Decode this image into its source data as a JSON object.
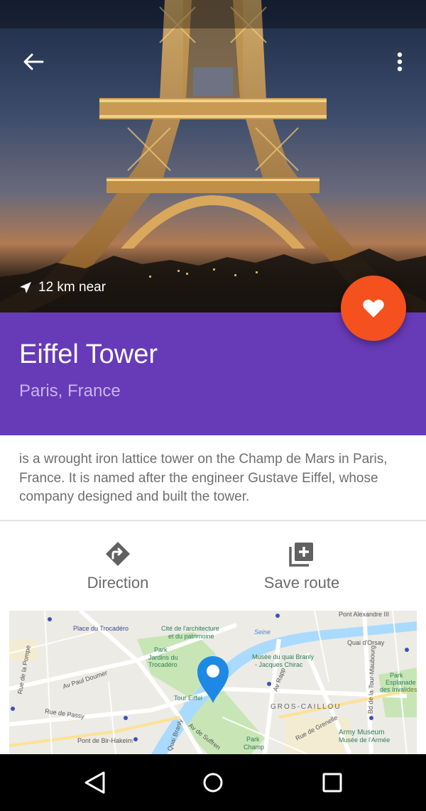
{
  "hero": {
    "distance_text": "12 km near"
  },
  "place": {
    "title": "Eiffel Tower",
    "subtitle": "Paris, France",
    "description": "is a wrought iron lattice tower on the Champ de Mars in Paris, France. It is named after the engineer Gustave Eiffel, whose company designed and built the tower."
  },
  "actions": {
    "direction_label": "Direction",
    "save_label": "Save route"
  },
  "map": {
    "labels": {
      "pont_alexandre": "Pont Alexandre III",
      "trocadero": "Place du Trocadéro",
      "cite_archi_1": "Cité de l'architecture",
      "cite_archi_2": "et du patrimoine",
      "seine": "Seine",
      "quai_orsay": "Quai d'Orsay",
      "jardins_1": "Park",
      "jardins_2": "Jardins du",
      "jardins_3": "Trocadéro",
      "branly_1": "Musée du quai Branly",
      "branly_2": "- Jacques Chirac",
      "paul_doumer": "Av Paul Doumer",
      "rue_pompe": "Rue de la Pompe",
      "invalides_1": "Park",
      "invalides_2": "Esplanade",
      "invalides_3": "des Invalides",
      "tour_eiffel": "Tour Eiffel",
      "av_rapp": "Av Rapp",
      "gros_caillou": "GROS-CAILLOU",
      "tour_maubourg": "Bd de la Tour-Maubourg",
      "rue_passy": "Rue de Passy",
      "rue_grenelle": "Rue de Grenelle",
      "bir_hakeim": "Pont de Bir-Hakeim",
      "quai_branly": "Quai Branly",
      "av_suffren": "Av de Suffren",
      "champ_1": "Park",
      "champ_2": "Champ",
      "army_1": "Army Museum",
      "army_2": "Musée de l'Armée"
    }
  },
  "colors": {
    "primary": "#673ab7",
    "accent": "#f4511e",
    "subtitle": "#c8b4ea",
    "map_pin": "#1e88e5"
  },
  "icons": {
    "back": "arrow-left-icon",
    "menu": "more-vert-icon",
    "distance": "navigation-arrow-icon",
    "favorite": "heart-icon",
    "direction": "directions-icon",
    "save": "library-add-icon",
    "pin": "map-pin-icon"
  }
}
